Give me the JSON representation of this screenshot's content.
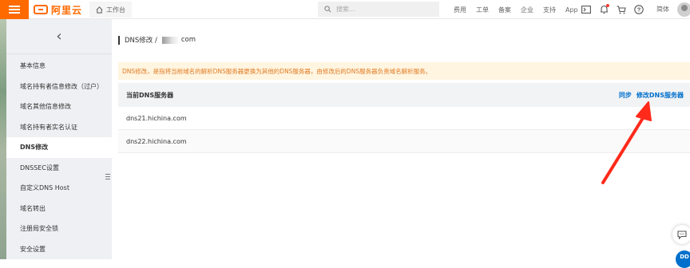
{
  "header": {
    "brand": "阿里云",
    "workbench_label": "工作台",
    "search_placeholder": "搜索...",
    "nav_links": [
      "费用",
      "工单",
      "备案",
      "企业",
      "支持",
      "App"
    ],
    "lang_label": "简体",
    "brand_color": "#ff6a00",
    "icons": [
      "terminal-icon",
      "bell-icon",
      "cart-icon",
      "help-icon"
    ]
  },
  "sidebar": {
    "collapse_glyph": "‹",
    "items": [
      {
        "label": "基本信息",
        "active": false
      },
      {
        "label": "域名持有者信息修改（过户）",
        "active": false
      },
      {
        "label": "域名其他信息修改",
        "active": false
      },
      {
        "label": "域名持有者实名认证",
        "active": false
      },
      {
        "label": "DNS修改",
        "active": true
      },
      {
        "label": "DNSSEC设置",
        "active": false
      },
      {
        "label": "自定义DNS Host",
        "active": false
      },
      {
        "label": "域名转出",
        "active": false
      },
      {
        "label": "注册局安全锁",
        "active": false
      },
      {
        "label": "安全设置",
        "active": false
      }
    ]
  },
  "main": {
    "breadcrumb_prefix": "DNS修改 /",
    "breadcrumb_suffix": "com",
    "notice": "DNS修改，是指将当前域名的解析DNS服务器更换为其他的DNS服务器，由修改后的DNS服务器负责域名解析服务。",
    "table": {
      "header": "当前DNS服务器",
      "action_sync": "同步",
      "action_modify": "修改DNS服务器",
      "rows": [
        "dns21.hichina.com",
        "dns22.hichina.com"
      ]
    },
    "link_color": "#0070cc",
    "notice_color": "#e07a22",
    "annotation_color": "#ff2a1a"
  },
  "floating": {
    "chat_icon": "chat-icon",
    "badge_text": "DD"
  }
}
